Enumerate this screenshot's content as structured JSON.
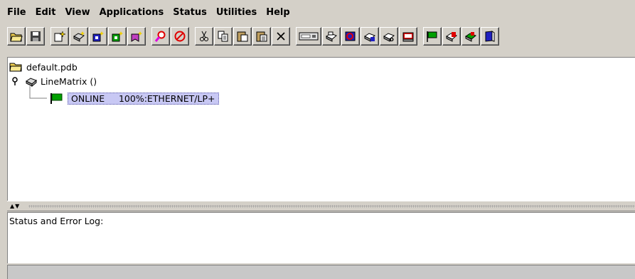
{
  "menubar": {
    "items": [
      "File",
      "Edit",
      "View",
      "Applications",
      "Status",
      "Utilities",
      "Help"
    ]
  },
  "toolbar": {
    "buttons": [
      "open-folder-icon",
      "save-icon",
      "new-document-icon",
      "new-printer-icon",
      "configure-blue-icon",
      "configure-green-icon",
      "add-bookmark-icon",
      "find-icon",
      "stop-icon",
      "cut-icon",
      "copy-icon",
      "paste-icon",
      "paste-special-icon",
      "delete-icon",
      "printer-panel-icon",
      "printer-status-icon",
      "printer-config-icon",
      "printer-options-icon",
      "printer-download-icon",
      "printer-test-icon",
      "online-flag-icon",
      "printer-alert-icon",
      "printer-refresh-icon",
      "help-book-icon"
    ]
  },
  "tree": {
    "root": "default.pdb",
    "printer": "LineMatrix ()",
    "status": "ONLINE     100%:ETHERNET/LP+"
  },
  "log": {
    "title": "Status and Error Log:"
  },
  "colors": {
    "selection_bg": "#c8c8f4",
    "flag_green": "#00a000",
    "stop_red": "#e00000",
    "folder_yellow": "#f0d050"
  }
}
